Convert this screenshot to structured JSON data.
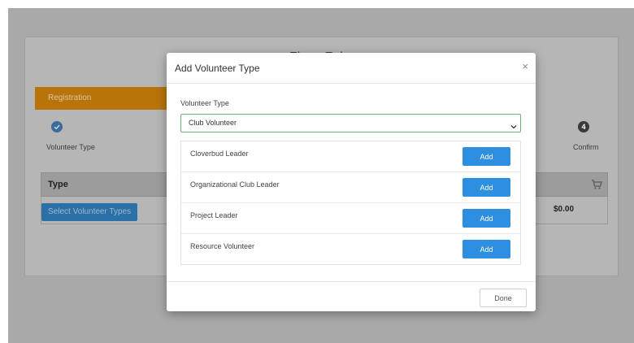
{
  "page": {
    "title": "Finny Fake",
    "registration_label": "Registration",
    "steps": [
      {
        "label": "Volunteer Type",
        "icon": "check-icon"
      },
      {
        "number": "4",
        "label": "Confirm"
      }
    ],
    "table": {
      "type_header": "Type",
      "cart_icon": "cart-icon",
      "select_button_label": "Select Volunteer Types",
      "total": "$0.00"
    }
  },
  "modal": {
    "title": "Add Volunteer Type",
    "close_label": "×",
    "field_label": "Volunteer Type",
    "selected_value": "Club Volunteer",
    "items": [
      {
        "label": "Cloverbud Leader",
        "button": "Add"
      },
      {
        "label": "Organizational Club Leader",
        "button": "Add"
      },
      {
        "label": "Project Leader",
        "button": "Add"
      },
      {
        "label": "Resource Volunteer",
        "button": "Add"
      }
    ],
    "done_label": "Done"
  },
  "colors": {
    "accent": "#2e8ee0",
    "registration_bar": "#b8740a",
    "select_border": "#6fb37a"
  }
}
